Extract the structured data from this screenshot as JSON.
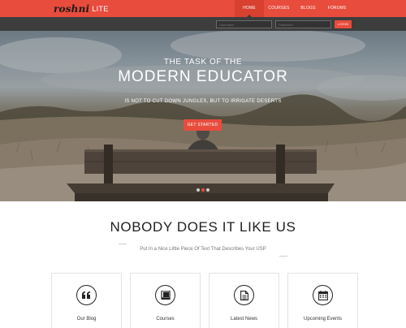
{
  "brand": {
    "logo_mark": "roshni",
    "logo_sub": "LITE",
    "accent": "#e84c3d"
  },
  "nav": {
    "items": [
      {
        "label": "HOME",
        "active": true
      },
      {
        "label": "COURSES",
        "active": false
      },
      {
        "label": "BLOGS",
        "active": false
      },
      {
        "label": "FORUMS",
        "active": false
      }
    ]
  },
  "login": {
    "username_placeholder": "Username",
    "password_placeholder": "Password",
    "button_label": "LOGIN"
  },
  "hero": {
    "line1": "THE TASK OF THE",
    "line2": "MODERN EDUCATOR",
    "tagline": "IS NOT TO CUT DOWN JUNGLES, BUT TO IRRIGATE DESERTS",
    "cta_label": "GET STARTED",
    "slides": 3,
    "active_slide": 1
  },
  "section": {
    "title": "NOBODY DOES IT LIKE US",
    "subtitle": "Put In a Nice Little Piece Of Text That Describes Your USP",
    "cards": [
      {
        "label": "Our Blog",
        "icon": "quote-icon"
      },
      {
        "label": "Courses",
        "icon": "book-icon"
      },
      {
        "label": "Latest News",
        "icon": "document-icon"
      },
      {
        "label": "Upcoming Events",
        "icon": "calendar-icon"
      }
    ]
  }
}
